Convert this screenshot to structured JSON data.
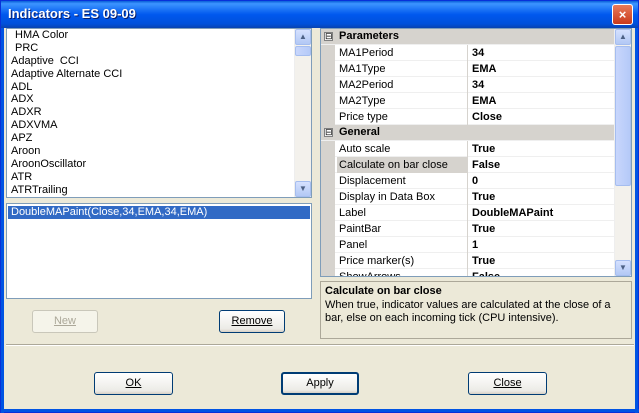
{
  "window": {
    "title": "Indicators - ES 09-09",
    "close_glyph": "×"
  },
  "indicator_list": {
    "items": [
      "HMA Color",
      "PRC",
      "Adaptive  CCI",
      "Adaptive Alternate CCI",
      "ADL",
      "ADX",
      "ADXR",
      "ADXVMA",
      "APZ",
      "Aroon",
      "AroonOscillator",
      "ATR",
      "ATRTrailing"
    ],
    "indent": [
      true,
      true,
      false,
      false,
      false,
      false,
      false,
      false,
      false,
      false,
      false,
      false,
      false
    ]
  },
  "selected_list": {
    "items": [
      "DoubleMAPaint(Close,34,EMA,34,EMA)"
    ]
  },
  "buttons": {
    "new_label": "New",
    "remove_label": "Remove",
    "ok_label": "OK",
    "apply_label": "Apply",
    "close_label": "Close"
  },
  "properties": {
    "categories": [
      {
        "name": "Parameters",
        "expander": "⊟",
        "rows": [
          {
            "name": "MA1Period",
            "value": "34"
          },
          {
            "name": "MA1Type",
            "value": "EMA"
          },
          {
            "name": "MA2Period",
            "value": "34"
          },
          {
            "name": "MA2Type",
            "value": "EMA"
          },
          {
            "name": "Price type",
            "value": "Close"
          }
        ]
      },
      {
        "name": "General",
        "expander": "⊟",
        "rows": [
          {
            "name": "Auto scale",
            "value": "True"
          },
          {
            "name": "Calculate on bar close",
            "value": "False",
            "highlighted": true
          },
          {
            "name": "Displacement",
            "value": "0"
          },
          {
            "name": "Display in Data Box",
            "value": "True"
          },
          {
            "name": "Label",
            "value": "DoubleMAPaint"
          },
          {
            "name": "PaintBar",
            "value": "True"
          },
          {
            "name": "Panel",
            "value": "1"
          },
          {
            "name": "Price marker(s)",
            "value": "True"
          },
          {
            "name": "ShowArrows",
            "value": "False"
          }
        ]
      }
    ]
  },
  "description": {
    "title": "Calculate on bar close",
    "text": "When true, indicator values are calculated at the close of a bar, else on each incoming tick (CPU intensive)."
  },
  "icons": {
    "scroll_up": "▲",
    "scroll_down": "▼"
  },
  "colors": {
    "title_bar": "#0054E3",
    "selection": "#316AC5",
    "dialog_bg": "#ECE9D8"
  }
}
